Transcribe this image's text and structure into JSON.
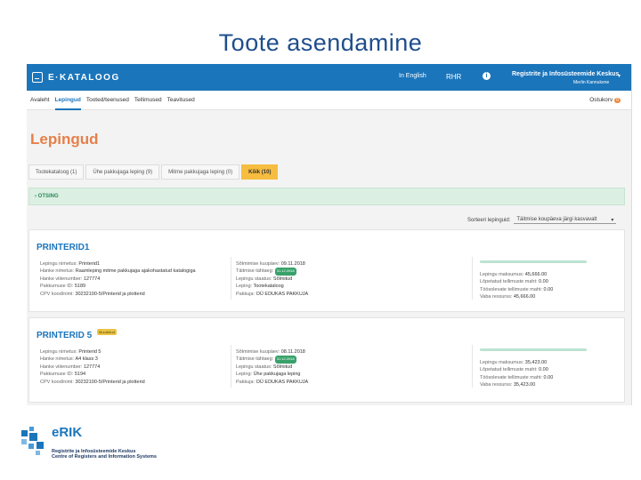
{
  "slide": {
    "title": "Toote asendamine"
  },
  "topbar": {
    "logo_text": "E·KATALOOG",
    "language": "In English",
    "rhr": "RHR",
    "info": "i",
    "organization": "Registrite ja Infosüsteemide Keskus",
    "user": "Merlin Kannukene",
    "caret": "▾"
  },
  "nav": {
    "items": [
      "Avaleht",
      "Lepingud",
      "Tooted/teenused",
      "Tellimused",
      "Teavitused"
    ],
    "active": "Lepingud",
    "cart_label": "Ostukorv",
    "cart_count": "0"
  },
  "page": {
    "heading": "Lepingud"
  },
  "tabs": [
    {
      "label": "Tootekataloog (1)"
    },
    {
      "label": "Ühe pakkujaga leping (9)"
    },
    {
      "label": "Mitme pakkujaga leping (0)"
    },
    {
      "label": "Kõik (10)"
    }
  ],
  "filter": {
    "label": "› OTSING"
  },
  "sort": {
    "label": "Sorteeri lepinguid:",
    "value": "Täitmise koupäeva järgi kasvavalt",
    "caret": "▾"
  },
  "contracts": [
    {
      "name": "PRINTERID1",
      "tag": "",
      "col1": [
        {
          "k": "Lepingu nimetus:",
          "v": "Printerid1"
        },
        {
          "k": "Hanke nimetus:",
          "v": "Raamleping mitme pakkujaga ajakohastatud katalogiga"
        },
        {
          "k": "Hanke viitenumber:",
          "v": "127774"
        },
        {
          "k": "Pakkumuse ID:",
          "v": "5189"
        },
        {
          "k": "CPV kood/nimi:",
          "v": "30232100-5/Printerid ja plotterid"
        }
      ],
      "col2": [
        {
          "k": "Sõlmimise kuupäev:",
          "v": "09.11.2018"
        },
        {
          "k": "Täitmise tähtaeg:",
          "v": "",
          "pill": "31.12.2018"
        },
        {
          "k": "Lepingu staatus:",
          "v": "Sõlmitud"
        },
        {
          "k": "Leping:",
          "v": "Tootekataloog"
        },
        {
          "k": "Pakkuja:",
          "v": "OÜ EDUKAS PAKKUJA"
        }
      ],
      "col3": [
        {
          "k": "Lepingu maksumus:",
          "v": "45,666.00"
        },
        {
          "k": "Lõpetatud tellimuste maht:",
          "v": "0.00"
        },
        {
          "k": "Töösolevate tellimuste maht:",
          "v": "0.00"
        },
        {
          "k": "Vaba ressurss:",
          "v": "45,666.00"
        }
      ],
      "used_fraction": 0.0
    },
    {
      "name": "PRINTERID 5",
      "tag": "Muudetud",
      "col1": [
        {
          "k": "Lepingu nimetus:",
          "v": "Printerid 5"
        },
        {
          "k": "Hanke nimetus:",
          "v": "A4 klass 3"
        },
        {
          "k": "Hanke viitenumber:",
          "v": "127774"
        },
        {
          "k": "Pakkumuse ID:",
          "v": "5194"
        },
        {
          "k": "CPV kood/nimi:",
          "v": "30232100-5/Printerid ja plotterid"
        }
      ],
      "col2": [
        {
          "k": "Sõlmimise kuupäev:",
          "v": "08.11.2018"
        },
        {
          "k": "Täitmise tähtaeg:",
          "v": "",
          "pill": "31.12.2018"
        },
        {
          "k": "Lepingu staatus:",
          "v": "Sõlmitud"
        },
        {
          "k": "Leping:",
          "v": "Ühe pakkujaga leping"
        },
        {
          "k": "Pakkuja:",
          "v": "OÜ EDUKAS PAKKUJA"
        }
      ],
      "col3": [
        {
          "k": "Lepingu maksumus:",
          "v": "35,423.00"
        },
        {
          "k": "Lõpetatud tellimuste maht:",
          "v": "0.00"
        },
        {
          "k": "Töösolevate tellimuste maht:",
          "v": "0.00"
        },
        {
          "k": "Vaba ressurss:",
          "v": "35,423.00"
        }
      ],
      "used_fraction": 0.0
    }
  ],
  "footer": {
    "brand": "eRIK",
    "line1": "Registrite ja Infosüsteemide Keskus",
    "line2": "Centre of Registers and Information Systems"
  },
  "colors": {
    "primary": "#1b75bb",
    "accent": "#e5804a",
    "active_tab": "#f6bd40"
  }
}
